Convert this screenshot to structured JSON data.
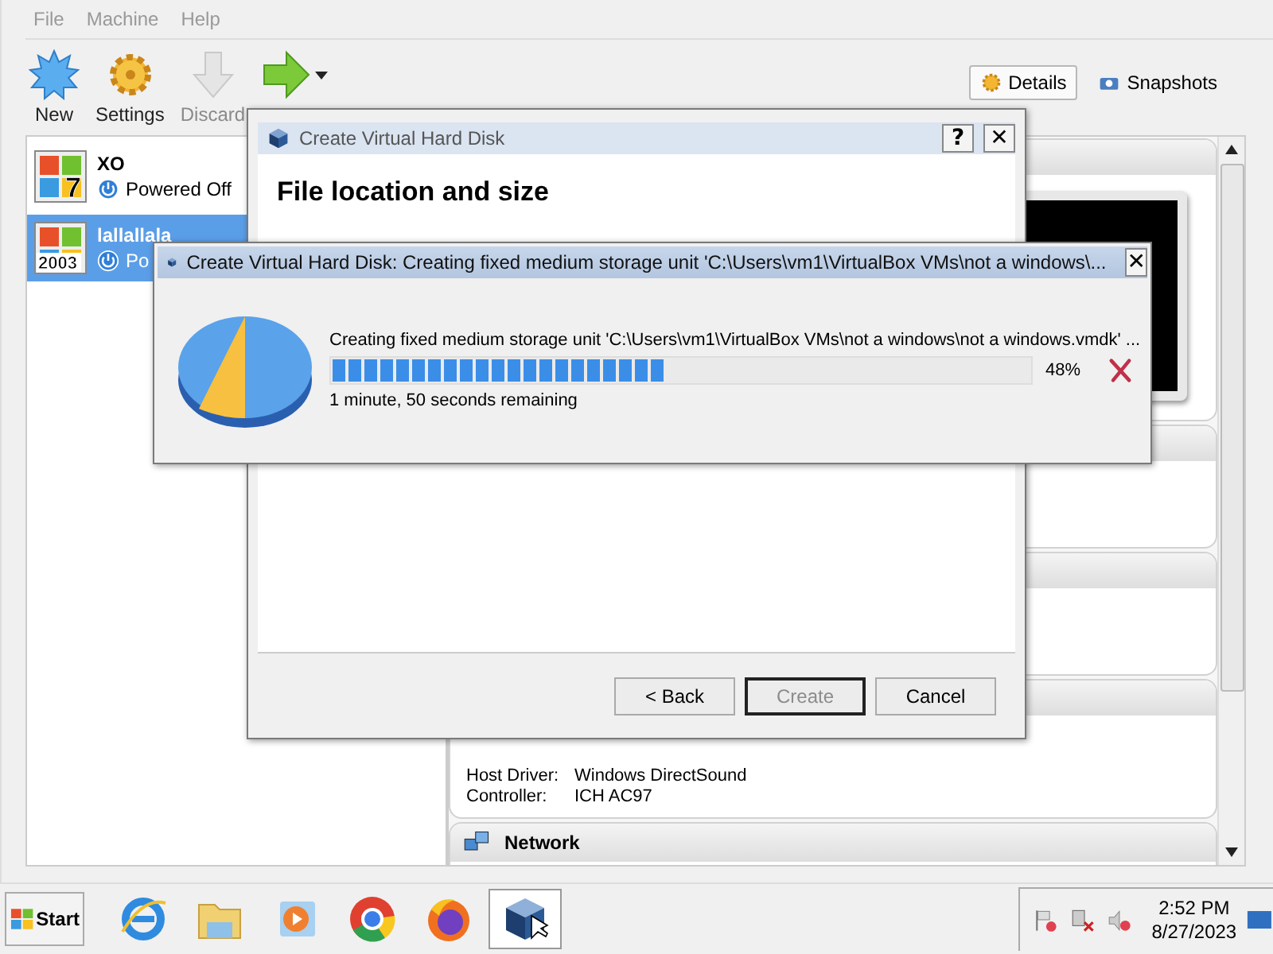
{
  "menu": [
    {
      "label": "File"
    },
    {
      "label": "Machine"
    },
    {
      "label": "Help"
    }
  ],
  "toolbar": [
    {
      "kind": "new",
      "label": "New",
      "disabled": false
    },
    {
      "kind": "settings",
      "label": "Settings",
      "disabled": false
    },
    {
      "kind": "discard",
      "label": "Discard",
      "disabled": true
    },
    {
      "kind": "start",
      "disabled": false
    }
  ],
  "view_tabs": [
    {
      "kind": "details",
      "label": "Details",
      "selected": true
    },
    {
      "kind": "snapshots",
      "label": "Snapshots",
      "selected": false
    }
  ],
  "vms": [
    {
      "name": "XO",
      "state": "Powered Off",
      "os_badge": "7",
      "selected": false
    },
    {
      "name": "lallallala",
      "state": "Po",
      "os_badge": "2003",
      "selected": true
    }
  ],
  "details": {
    "audio_rows": [
      {
        "label": "Host Driver:",
        "value": "Windows DirectSound"
      },
      {
        "label": "Controller:",
        "value": "ICH AC97"
      }
    ],
    "network_title": "Network"
  },
  "wizard": {
    "title": "Create Virtual Hard Disk",
    "help": "?",
    "close": "✕",
    "heading": "File location and size",
    "buttons": [
      {
        "label": "< Back",
        "disabled": false,
        "default": false
      },
      {
        "label": "Create",
        "disabled": true,
        "default": true
      },
      {
        "label": "Cancel",
        "disabled": false,
        "default": false
      }
    ]
  },
  "progress": {
    "title": "Create Virtual Hard Disk: Creating fixed medium storage unit 'C:\\Users\\vm1\\VirtualBox VMs\\not a windows\\...",
    "close": "✕",
    "message": "Creating fixed medium storage unit 'C:\\Users\\vm1\\VirtualBox VMs\\not a windows\\not a windows.vmdk' ...",
    "level": 0.48,
    "percent": "48%",
    "remaining": "1 minute, 50 seconds remaining"
  },
  "taskbar": {
    "start": "Start",
    "apps": [
      {
        "kind": "browser-e",
        "active": false
      },
      {
        "kind": "folder",
        "active": false
      },
      {
        "kind": "player",
        "active": false
      },
      {
        "kind": "chrome",
        "active": false
      },
      {
        "kind": "fox",
        "active": false
      },
      {
        "kind": "vbox",
        "active": true
      }
    ],
    "clock": {
      "time": "2:52 PM",
      "date": "8/27/2023"
    }
  }
}
